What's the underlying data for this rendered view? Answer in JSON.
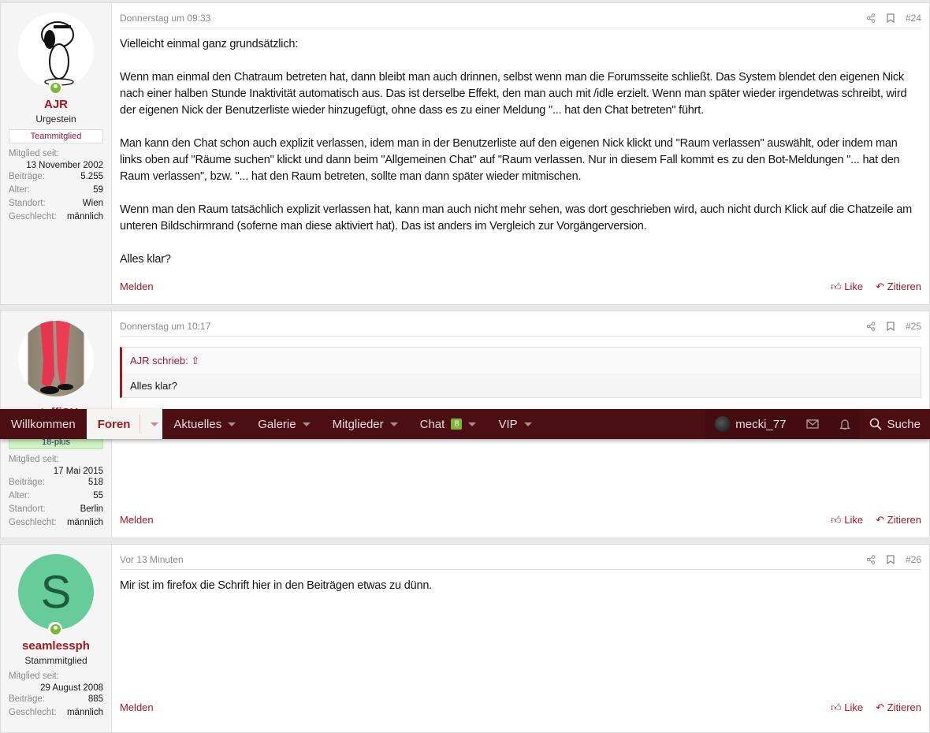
{
  "colors": {
    "accent": "#a1191f",
    "nav_bg": "#4b0e12",
    "online": "#7cb82f",
    "chat_badge": "#7cb82f"
  },
  "nav": {
    "items": [
      {
        "label": "Willkommen"
      },
      {
        "label": "Foren",
        "active": true
      },
      {
        "label": "Aktuelles"
      },
      {
        "label": "Galerie"
      },
      {
        "label": "Mitglieder"
      },
      {
        "label": "Chat",
        "badge": "8"
      },
      {
        "label": "VIP"
      }
    ],
    "user": "mecki_77",
    "search": "Suche",
    "icons": [
      "envelope-icon",
      "bell-icon",
      "search-icon"
    ]
  },
  "posts": [
    {
      "number": "#24",
      "date": "Donnerstag um 09:33",
      "user": {
        "name": "AJR",
        "rank": "Urgestein",
        "banner": "Teammitglied",
        "online": true,
        "stats": {
          "joined_label": "Mitglied seit:",
          "joined": "13 November 2002",
          "posts_label": "Beiträge:",
          "posts": "5.255",
          "age_label": "Alter:",
          "age": "59",
          "location_label": "Standort:",
          "location": "Wien",
          "gender_label": "Geschlecht:",
          "gender": "männlich"
        }
      },
      "paragraphs": [
        "Vielleicht einmal ganz grundsätzlich:",
        "Wenn man einmal den Chatraum betreten hat, dann bleibt man auch drinnen, selbst wenn man die Forumsseite schließt. Das System blendet den eigenen Nick nach einer halben Stunde Inaktivität automatisch aus. Das ist derselbe Effekt, den man auch mit /idle erzielt. Wenn man später wieder irgendetwas schreibt, wird der eigenen Nick der Benutzerliste wieder hinzugefügt, ohne dass es zu einer Meldung \"... hat den Chat betreten\" führt.",
        "Man kann den Chat schon auch explizit verlassen, idem man in der Benutzerliste auf den eigenen Nick klickt und \"Raum verlassen\" auswählt, oder indem man links oben auf \"Räume suchen\" klickt und dann beim \"Allgemeinen Chat\" auf \"Raum verlassen. Nur in diesem Fall kommt es zu den Bot-Meldungen \"... hat den Raum verlassen\", bzw. \"... hat den Raum betreten, sollte man dann später wieder mitmischen.",
        "Wenn man den Raum tatsächlich explizit verlassen hat, kann man auch nicht mehr sehen, was dort geschrieben wird, auch nicht durch Klick auf die Chatzeile am unteren Bildschirmrand (soferne man diese aktiviert hat). Das ist anders im Vergleich zur Vorgängerversion.",
        "Alles klar?"
      ]
    },
    {
      "number": "#25",
      "date": "Donnerstag um 10:17",
      "user": {
        "name": "steffiSH",
        "banner": "18-plus",
        "stats": {
          "joined_label": "Mitglied seit:",
          "joined": "17 Mai 2015",
          "posts_label": "Beiträge:",
          "posts": "518",
          "age_label": "Alter:",
          "age": "55",
          "location_label": "Standort:",
          "location": "Berlin",
          "gender_label": "Geschlecht:",
          "gender": "männlich"
        }
      },
      "quote": {
        "author": "AJR schrieb:",
        "text": "Alles klar?"
      }
    },
    {
      "number": "#26",
      "date": "Vor 13 Minuten",
      "user": {
        "name": "seamlessph",
        "rank": "Stammmitglied",
        "avatar_letter": "S",
        "avatar_color": "#66cc99",
        "online": true,
        "stats": {
          "joined_label": "Mitglied seit:",
          "joined": "29 August 2008",
          "posts_label": "Beiträge:",
          "posts": "885",
          "gender_label": "Geschlecht:",
          "gender": "männlich"
        }
      },
      "paragraphs": [
        "Mir ist im firefox die Schrift hier in den Beiträgen etwas zu dünn."
      ]
    }
  ],
  "actions": {
    "report": "Melden",
    "like": "Like",
    "quote": "Zitieren"
  }
}
